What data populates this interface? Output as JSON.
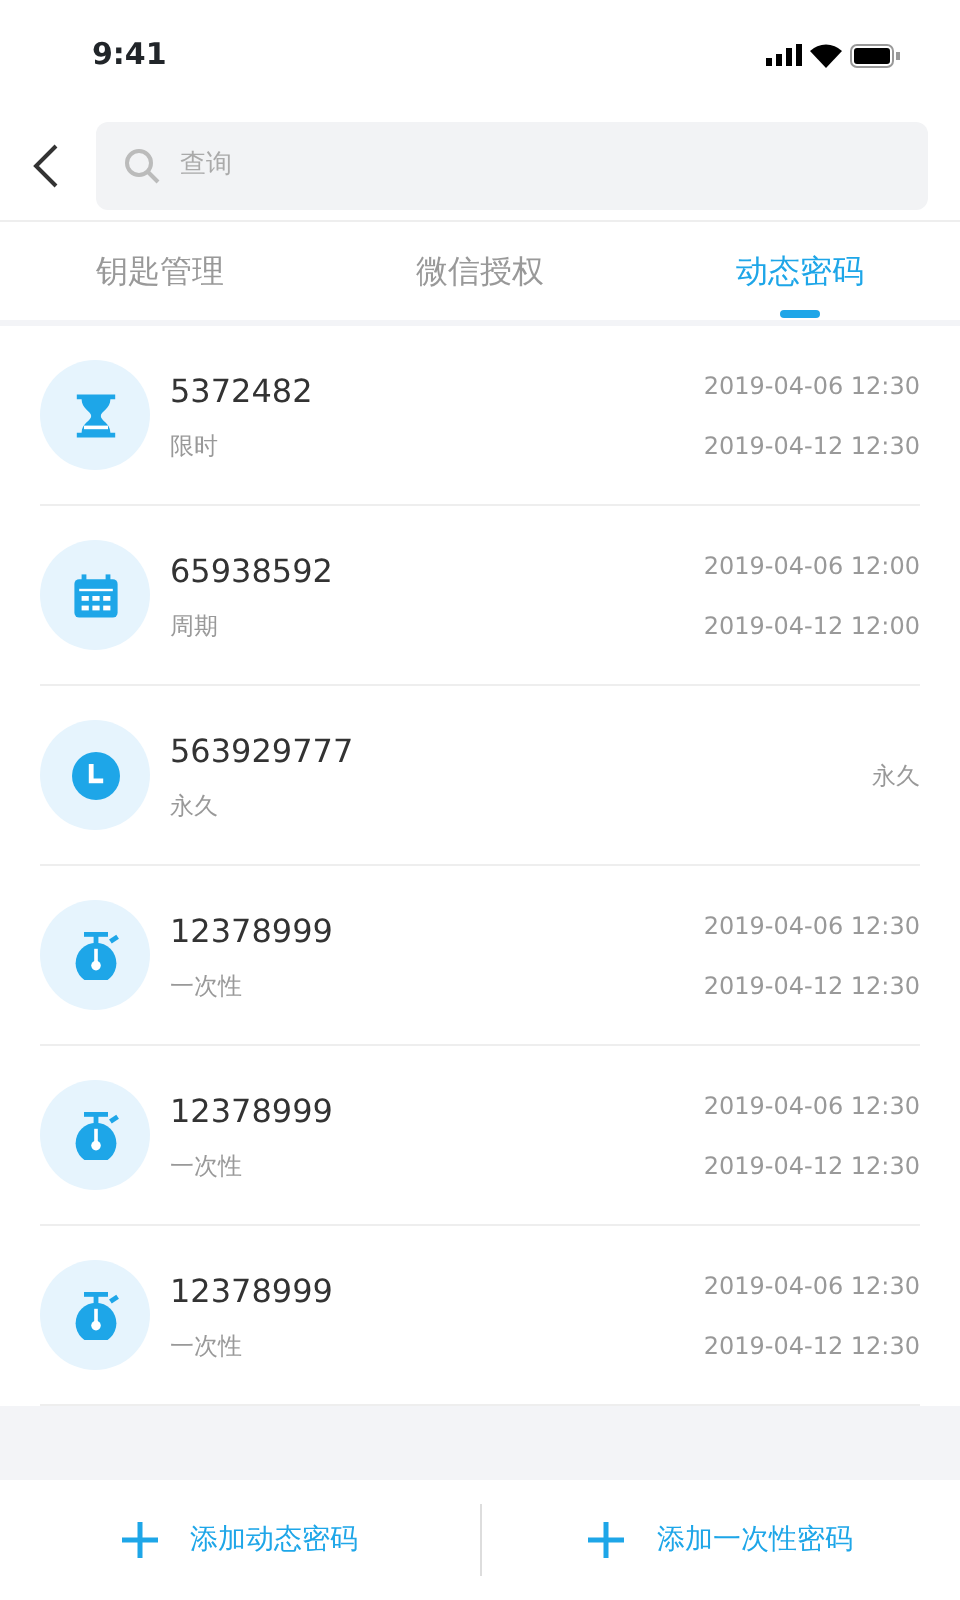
{
  "status_bar": {
    "time": "9:41"
  },
  "search": {
    "placeholder": "查询"
  },
  "tabs": [
    {
      "label": "钥匙管理",
      "selected": false
    },
    {
      "label": "微信授权",
      "selected": false
    },
    {
      "label": "动态密码",
      "selected": true
    }
  ],
  "passwords": [
    {
      "kind": "timed",
      "code": "5372482",
      "type": "限时",
      "dates": [
        "2019-04-06 12:30",
        "2019-04-12 12:30"
      ]
    },
    {
      "kind": "periodic",
      "code": "65938592",
      "type": "周期",
      "dates": [
        "2019-04-06 12:00",
        "2019-04-12 12:00"
      ]
    },
    {
      "kind": "permanent",
      "code": "563929777",
      "type": "永久",
      "dates": [
        "永久"
      ]
    },
    {
      "kind": "once",
      "code": "12378999",
      "type": "一次性",
      "dates": [
        "2019-04-06 12:30",
        "2019-04-12 12:30"
      ]
    },
    {
      "kind": "once",
      "code": "12378999",
      "type": "一次性",
      "dates": [
        "2019-04-06 12:30",
        "2019-04-12 12:30"
      ]
    },
    {
      "kind": "once",
      "code": "12378999",
      "type": "一次性",
      "dates": [
        "2019-04-06 12:30",
        "2019-04-12 12:30"
      ]
    }
  ],
  "footer_buttons": [
    {
      "label": "添加动态密码"
    },
    {
      "label": "添加一次性密码"
    }
  ]
}
